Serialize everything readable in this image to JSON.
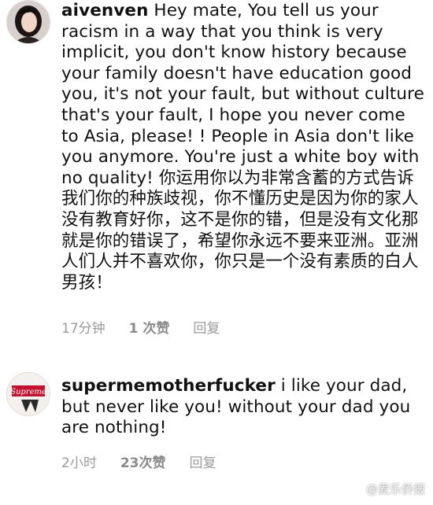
{
  "comments": [
    {
      "username": "aivenven",
      "text": "Hey mate, You tell us your racism in a way that you think is very implicit, you don't know history because your family doesn't have education good you, it's not your fault, but without culture that's your fault, I hope you never come to Asia, please! ! People in Asia don't like you anymore. You're just a white boy with no quality! 你运用你以为非常含蓄的方式告诉我们你的种族歧视，你不懂历史是因为你的家人没有教育好你，这不是你的错，但是没有文化那就是你的错误了，希望你永远不要来亚洲。亚洲人们人并不喜欢你，你只是一个没有素质的白人男孩！",
      "time": "17分钟",
      "likes": "1 次赞",
      "reply": "回复",
      "avatar_icon": "woman-portrait-avatar"
    },
    {
      "username": "supermemotherfucker",
      "text": "i like your dad, but never like you! without your dad you are nothing!",
      "time": "2小时",
      "likes": "23次赞",
      "reply": "回复",
      "avatar_icon": "supreme-logo-avatar",
      "avatar_text": "Supreme"
    }
  ],
  "watermark": {
    "icon": "weibo-icon",
    "text": "@麦乐侨报"
  }
}
